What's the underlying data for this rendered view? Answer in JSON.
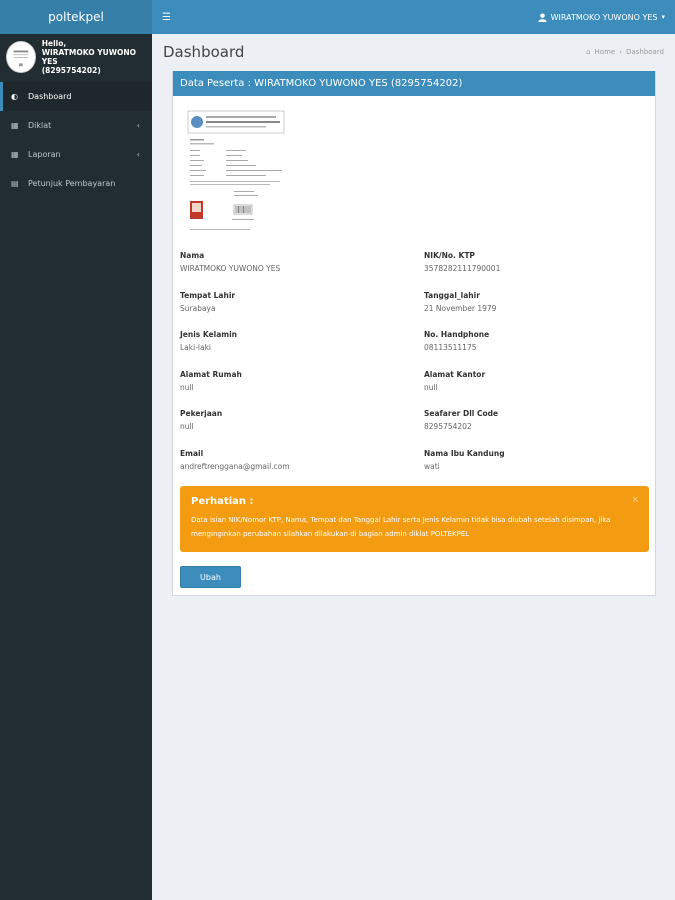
{
  "app": {
    "logo": "poltekpel"
  },
  "navbar": {
    "toggle_icon": "hamburger-icon",
    "user_name": "WIRATMOKO YUWONO YES",
    "caret": "▾"
  },
  "sidebar": {
    "greeting": "Hello,",
    "user_name": "WIRATMOKO YUWONO YES",
    "user_id": "(8295754202)",
    "items": [
      {
        "label": "Dashboard",
        "icon": "dashboard-icon"
      },
      {
        "label": "Diklat",
        "icon": "table-icon"
      },
      {
        "label": "Laporan",
        "icon": "table-icon"
      },
      {
        "label": "Petunjuk Pembayaran",
        "icon": "book-icon"
      }
    ]
  },
  "header": {
    "title": "Dashboard",
    "breadcrumb_home": "Home",
    "breadcrumb_sep": "›",
    "breadcrumb_current": "Dashboard"
  },
  "box": {
    "title": "Data Peserta : WIRATMOKO YUWONO YES (8295754202)"
  },
  "fields": {
    "nama": {
      "label": "Nama",
      "value": "WIRATMOKO YUWONO YES"
    },
    "nik": {
      "label": "NIK/No. KTP",
      "value": "3578282111790001"
    },
    "tempat_lahir": {
      "label": "Tempat Lahir",
      "value": "Surabaya"
    },
    "tanggal_lahir": {
      "label": "Tanggal_lahir",
      "value": "21 November 1979"
    },
    "jenis_kelamin": {
      "label": "Jenis Kelamin",
      "value": "Laki-laki"
    },
    "handphone": {
      "label": "No. Handphone",
      "value": "08113511175"
    },
    "alamat_rumah": {
      "label": "Alamat Rumah",
      "value": "null"
    },
    "alamat_kantor": {
      "label": "Alamat Kantor",
      "value": "null"
    },
    "pekerjaan": {
      "label": "Pekerjaan",
      "value": "null"
    },
    "seafarer": {
      "label": "Seafarer Dll Code",
      "value": "8295754202"
    },
    "email": {
      "label": "Email",
      "value": "andreftrenggana@gmail.com"
    },
    "ibu_kandung": {
      "label": "Nama Ibu Kandung",
      "value": "wati"
    }
  },
  "alert": {
    "title": "Perhatian :",
    "text": "Data isian NIK/Nomor KTP, Nama, Tempat dan Tanggal Lahir serta Jenis Kelamin tidak bisa diubah setelah disimpan, jika menginginkan perubahan silahkan dilakukan di bagian admin diklat POLTEKPEL",
    "close": "×",
    "color": "#f39c12"
  },
  "actions": {
    "edit_label": "Ubah"
  },
  "colors": {
    "primary": "#3c8dbc",
    "sidebar": "#222d32",
    "warning": "#f39c12"
  }
}
